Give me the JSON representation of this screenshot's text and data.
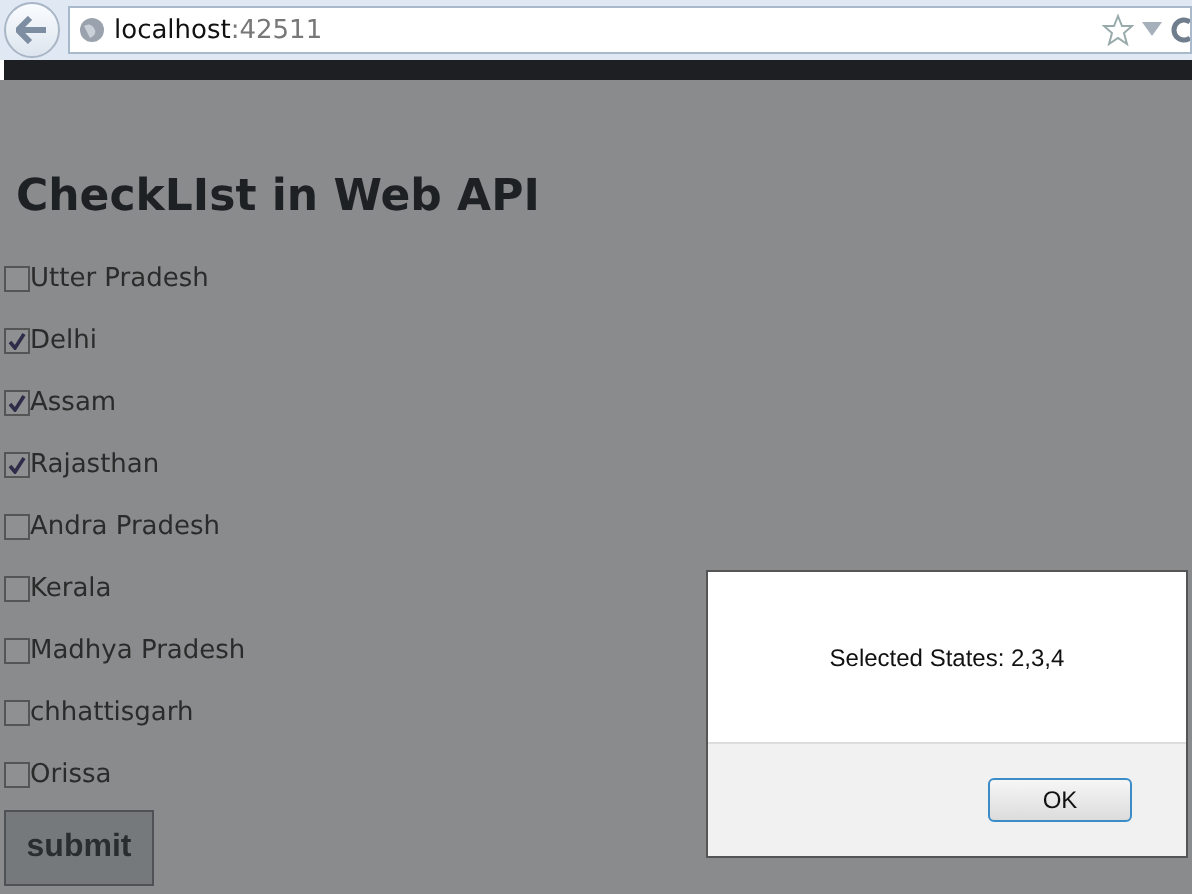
{
  "browser": {
    "url_host": "localhost",
    "url_port": ":42511"
  },
  "page": {
    "heading": "CheckLIst in Web API",
    "states": [
      {
        "label": "Utter Pradesh",
        "checked": false
      },
      {
        "label": "Delhi",
        "checked": true
      },
      {
        "label": "Assam",
        "checked": true
      },
      {
        "label": "Rajasthan",
        "checked": true
      },
      {
        "label": "Andra Pradesh",
        "checked": false
      },
      {
        "label": "Kerala",
        "checked": false
      },
      {
        "label": "Madhya Pradesh",
        "checked": false
      },
      {
        "label": "chhattisgarh",
        "checked": false
      },
      {
        "label": "Orissa",
        "checked": false
      }
    ],
    "submit": "submit"
  },
  "dialog": {
    "message": "Selected States: 2,3,4",
    "ok": "OK"
  }
}
